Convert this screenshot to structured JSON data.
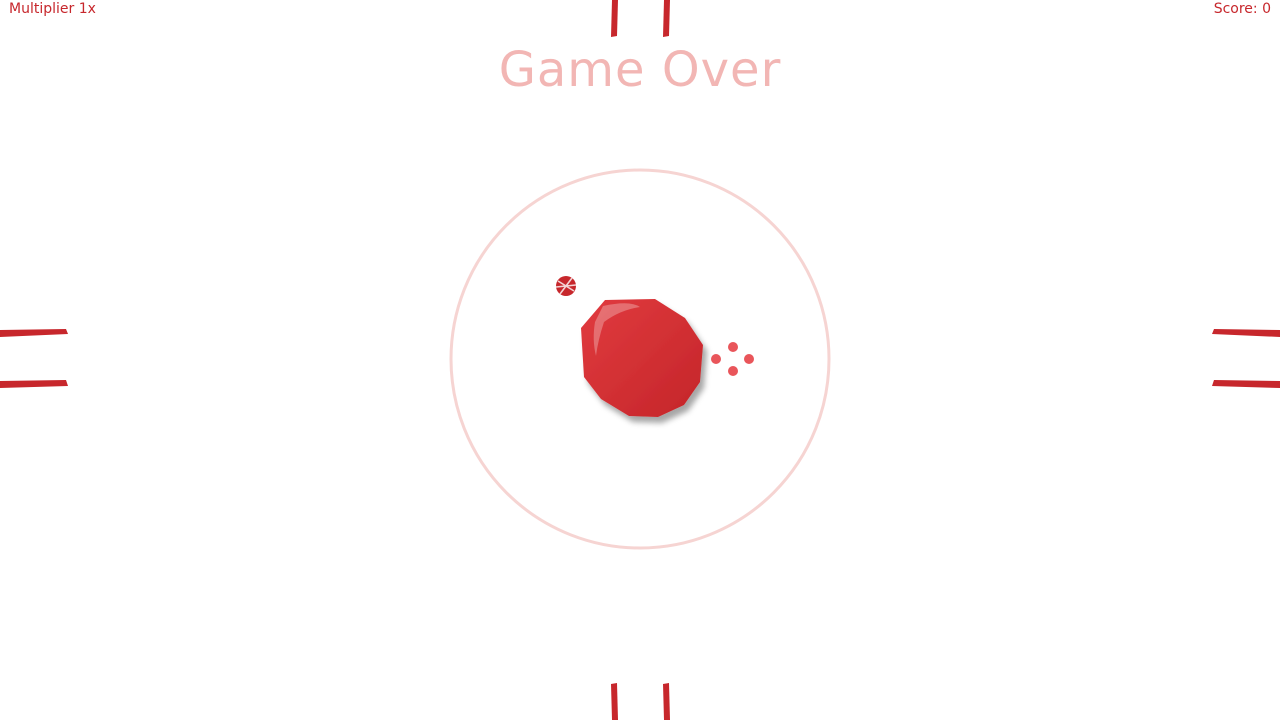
{
  "hud": {
    "multiplier_label": "Multiplier 1x",
    "score_label": "Score: 0"
  },
  "overlay": {
    "title": "Game Over"
  },
  "colors": {
    "accent": "#c7272c",
    "blob": "#d62f34",
    "ring": "#f6d4d2",
    "title": "#f2b6b4",
    "dots": "#e9555a"
  },
  "icons": {
    "player_blob": "red-blob",
    "small_ball": "striped-ball",
    "dots": "four-dots",
    "gates": "double-bar-gate"
  }
}
